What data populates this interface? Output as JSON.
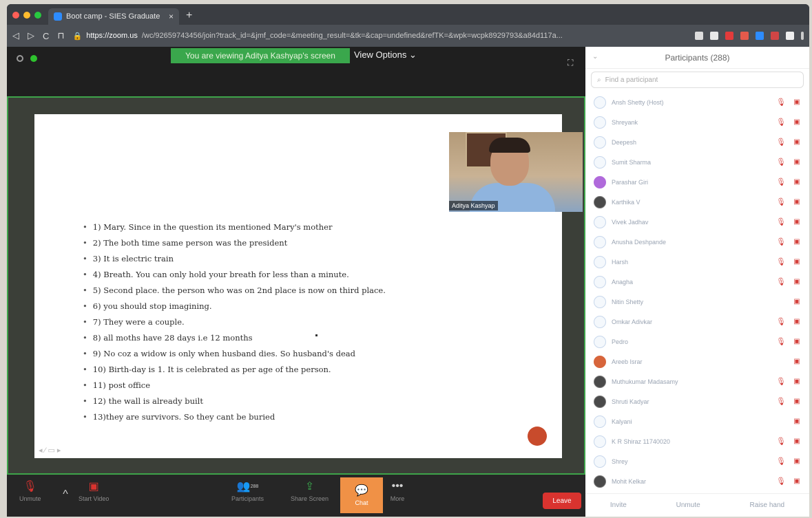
{
  "browser": {
    "tab_title": "Boot camp - SIES Graduate",
    "tab_close": "×",
    "new_tab": "+",
    "nav": {
      "back": "◁",
      "forward": "▷",
      "reload": "C",
      "bookmark": "⊓"
    },
    "url_host": "https://zoom.us",
    "url_path": "/wc/92659743456/join?track_id=&jmf_code=&meeting_result=&tk=&cap=undefined&refTK=&wpk=wcpk8929793&a84d117a..."
  },
  "meeting": {
    "viewing_banner": "You are viewing Aditya Kashyap's screen",
    "view_options": "View Options ⌄",
    "fullscreen_icon": "⛶",
    "speaker_name": "Aditya Kashyap",
    "slide_tools": "◂ ⁄ ▭ ▸",
    "answers": [
      "1) Mary. Since in the question its mentioned Mary's mother",
      "2) The both time same person was the president",
      "3) It is electric train",
      "4) Breath. You can only hold your breath for less than a minute.",
      "5) Second place. the person who was on 2nd place is now on third place.",
      "6) you should stop imagining.",
      "7) They were a couple.",
      "8) all moths have 28 days i.e 12 months",
      "9) No coz a widow is only when husband dies. So husband's dead",
      "10) Birth-day is 1. It is celebrated as per age of the person.",
      "11) post office",
      "12) the wall is already built",
      "13)they are survivors. So they cant be buried"
    ]
  },
  "toolbar": {
    "unmute": "Unmute",
    "start_video": "Start Video",
    "participants": "Participants",
    "participants_count": "288",
    "share_screen": "Share Screen",
    "chat": "Chat",
    "more": "More",
    "more_icon": "•••",
    "leave": "Leave"
  },
  "participants_panel": {
    "title": "Participants (288)",
    "collapse_icon": "⌄",
    "search_placeholder": "Find a participant",
    "participants": [
      {
        "name": "Ansh Shetty (Host)",
        "avatar": "default",
        "mic": true,
        "cam": true
      },
      {
        "name": "Shreyank",
        "avatar": "default",
        "mic": true,
        "cam": true
      },
      {
        "name": "Deepesh",
        "avatar": "default",
        "mic": true,
        "cam": true
      },
      {
        "name": "Sumit Sharma",
        "avatar": "default",
        "mic": true,
        "cam": true
      },
      {
        "name": "Parashar Giri",
        "avatar": "purple",
        "mic": true,
        "cam": true
      },
      {
        "name": "Karthika V",
        "avatar": "photo",
        "mic": true,
        "cam": true
      },
      {
        "name": "Vivek Jadhav",
        "avatar": "default",
        "mic": true,
        "cam": true
      },
      {
        "name": "Anusha Deshpande",
        "avatar": "default",
        "mic": true,
        "cam": true
      },
      {
        "name": "Harsh",
        "avatar": "default",
        "mic": true,
        "cam": true
      },
      {
        "name": "Anagha",
        "avatar": "default",
        "mic": true,
        "cam": true
      },
      {
        "name": "Nitin Shetty",
        "avatar": "default",
        "mic": false,
        "cam": true
      },
      {
        "name": "Omkar Adivkar",
        "avatar": "default",
        "mic": true,
        "cam": true
      },
      {
        "name": "Pedro",
        "avatar": "default",
        "mic": true,
        "cam": true
      },
      {
        "name": "Areeb Israr",
        "avatar": "orange",
        "mic": false,
        "cam": true
      },
      {
        "name": "Muthukumar Madasamy",
        "avatar": "photo",
        "mic": true,
        "cam": true
      },
      {
        "name": "Shruti Kadyar",
        "avatar": "photo",
        "mic": true,
        "cam": true
      },
      {
        "name": "Kalyani",
        "avatar": "default",
        "mic": false,
        "cam": true
      },
      {
        "name": "K R Shiraz 11740020",
        "avatar": "default",
        "mic": true,
        "cam": true
      },
      {
        "name": "Shrey",
        "avatar": "default",
        "mic": true,
        "cam": true
      },
      {
        "name": "Mohit Kelkar",
        "avatar": "photo",
        "mic": true,
        "cam": true
      }
    ],
    "footer": {
      "invite": "Invite",
      "unmute": "Unmute",
      "raise_hand": "Raise hand"
    }
  },
  "colors": {
    "accent": "#2d8cff",
    "banner_green": "#3aa74c",
    "leave_red": "#d9332f",
    "chat_orange": "#f09146"
  }
}
